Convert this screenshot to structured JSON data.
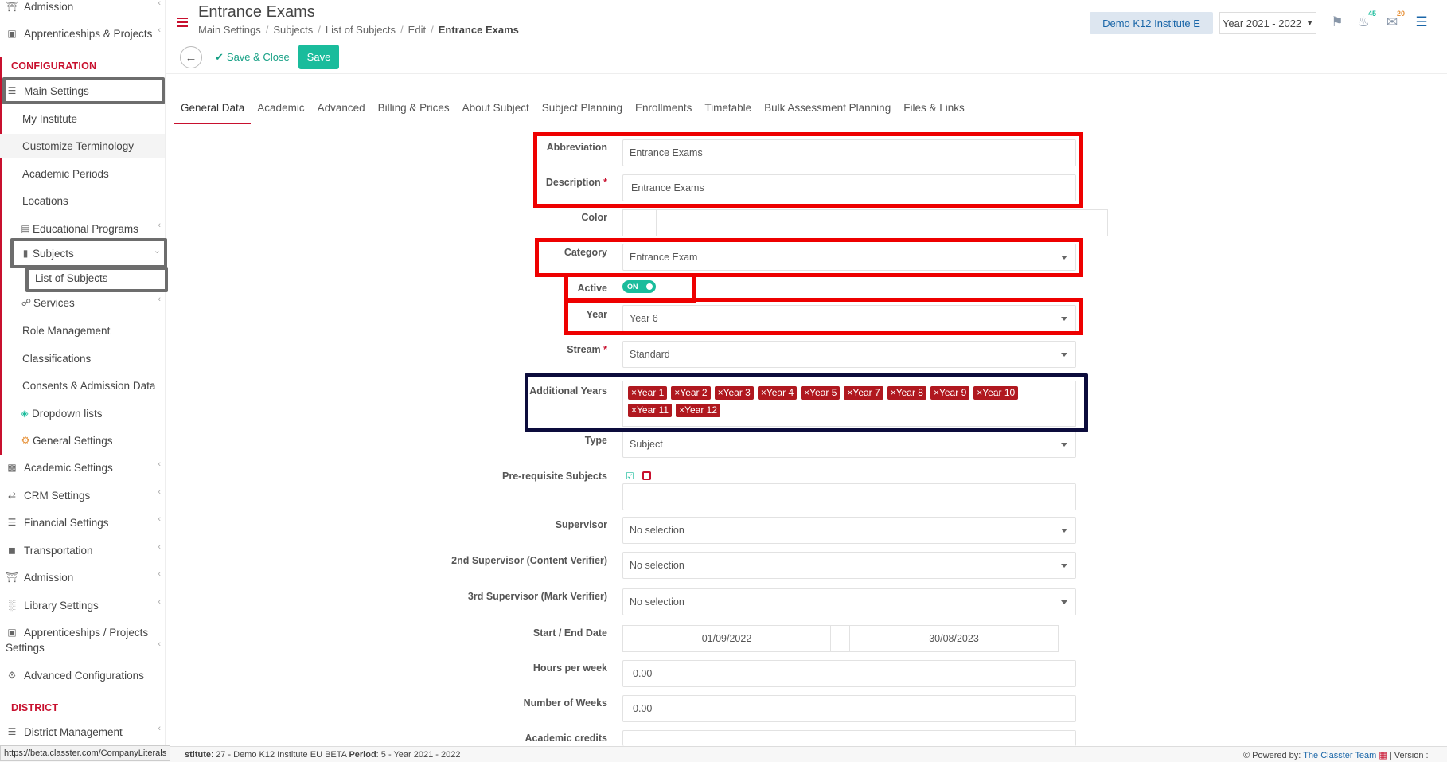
{
  "header": {
    "title": "Entrance Exams",
    "breadcrumb": [
      "Main Settings",
      "Subjects",
      "List of Subjects",
      "Edit",
      "Entrance Exams"
    ],
    "institute_button": "Demo K12 Institute E",
    "year_select": "Year 2021 - 2022",
    "notifications_count": "45",
    "messages_count": "20"
  },
  "toolbar": {
    "save_close_label": "Save & Close",
    "save_label": "Save"
  },
  "sidebar": {
    "top_items": [
      "Admission",
      "Apprenticeships & Projects"
    ],
    "configuration_header": "CONFIGURATION",
    "config_items": [
      "Main Settings",
      "My Institute",
      "Customize Terminology",
      "Academic Periods",
      "Locations",
      "Educational Programs",
      "Subjects",
      "List of Subjects",
      "Services",
      "Role Management",
      "Classifications",
      "Consents & Admission Data",
      "Dropdown lists",
      "General Settings"
    ],
    "settings_items": [
      "Academic Settings",
      "CRM Settings",
      "Financial Settings",
      "Transportation",
      "Admission",
      "Library Settings",
      "Apprenticeships / Projects",
      "Settings",
      "Advanced Configurations"
    ],
    "district_header": "DISTRICT",
    "district_items": [
      "District Management"
    ]
  },
  "tabs": [
    "General Data",
    "Academic",
    "Advanced",
    "Billing & Prices",
    "About Subject",
    "Subject Planning",
    "Enrollments",
    "Timetable",
    "Bulk Assessment Planning",
    "Files & Links"
  ],
  "form": {
    "abbreviation_label": "Abbreviation",
    "abbreviation_value": "Entrance Exams",
    "description_label": "Description",
    "description_value": "Entrance Exams",
    "color_label": "Color",
    "category_label": "Category",
    "category_value": "Entrance Exam",
    "active_label": "Active",
    "active_value": "ON",
    "year_label": "Year",
    "year_value": "Year 6",
    "stream_label": "Stream",
    "stream_value": "Standard",
    "additional_years_label": "Additional Years",
    "additional_years": [
      "Year 1",
      "Year 2",
      "Year 3",
      "Year 4",
      "Year 5",
      "Year 7",
      "Year 8",
      "Year 9",
      "Year 10",
      "Year 11",
      "Year 12"
    ],
    "type_label": "Type",
    "type_value": "Subject",
    "prereq_label": "Pre-requisite Subjects",
    "supervisor_label": "Supervisor",
    "supervisor_value": "No selection",
    "supervisor2_label": "2nd Supervisor (Content Verifier)",
    "supervisor2_value": "No selection",
    "supervisor3_label": "3rd Supervisor (Mark Verifier)",
    "supervisor3_value": "No selection",
    "dates_label": "Start / End Date",
    "start_date": "01/09/2022",
    "date_sep": "-",
    "end_date": "30/08/2023",
    "hours_label": "Hours per week",
    "hours_value": "0.00",
    "weeks_label": "Number of Weeks",
    "weeks_value": "0.00",
    "credits_label": "Academic credits"
  },
  "status": {
    "url": "https://beta.classter.com/CompanyLiterals",
    "info_prefix": "stitute",
    "info_mid": ": 27 - Demo K12 Institute EU BETA ",
    "info_period_label": "Period",
    "info_period": ": 5 - Year 2021 - 2022",
    "powered_prefix": "Powered by: ",
    "powered_brand": "The Classter Team",
    "version_label": "| Version :"
  }
}
